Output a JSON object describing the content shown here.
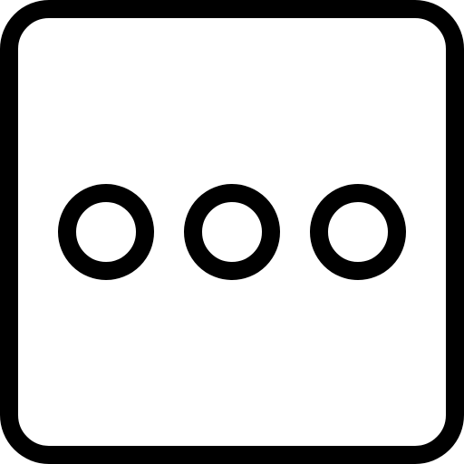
{
  "icon": {
    "name": "more-options-square-icon",
    "stroke_color": "#000000",
    "fill_color": "#ffffff",
    "dot_count": 3
  }
}
